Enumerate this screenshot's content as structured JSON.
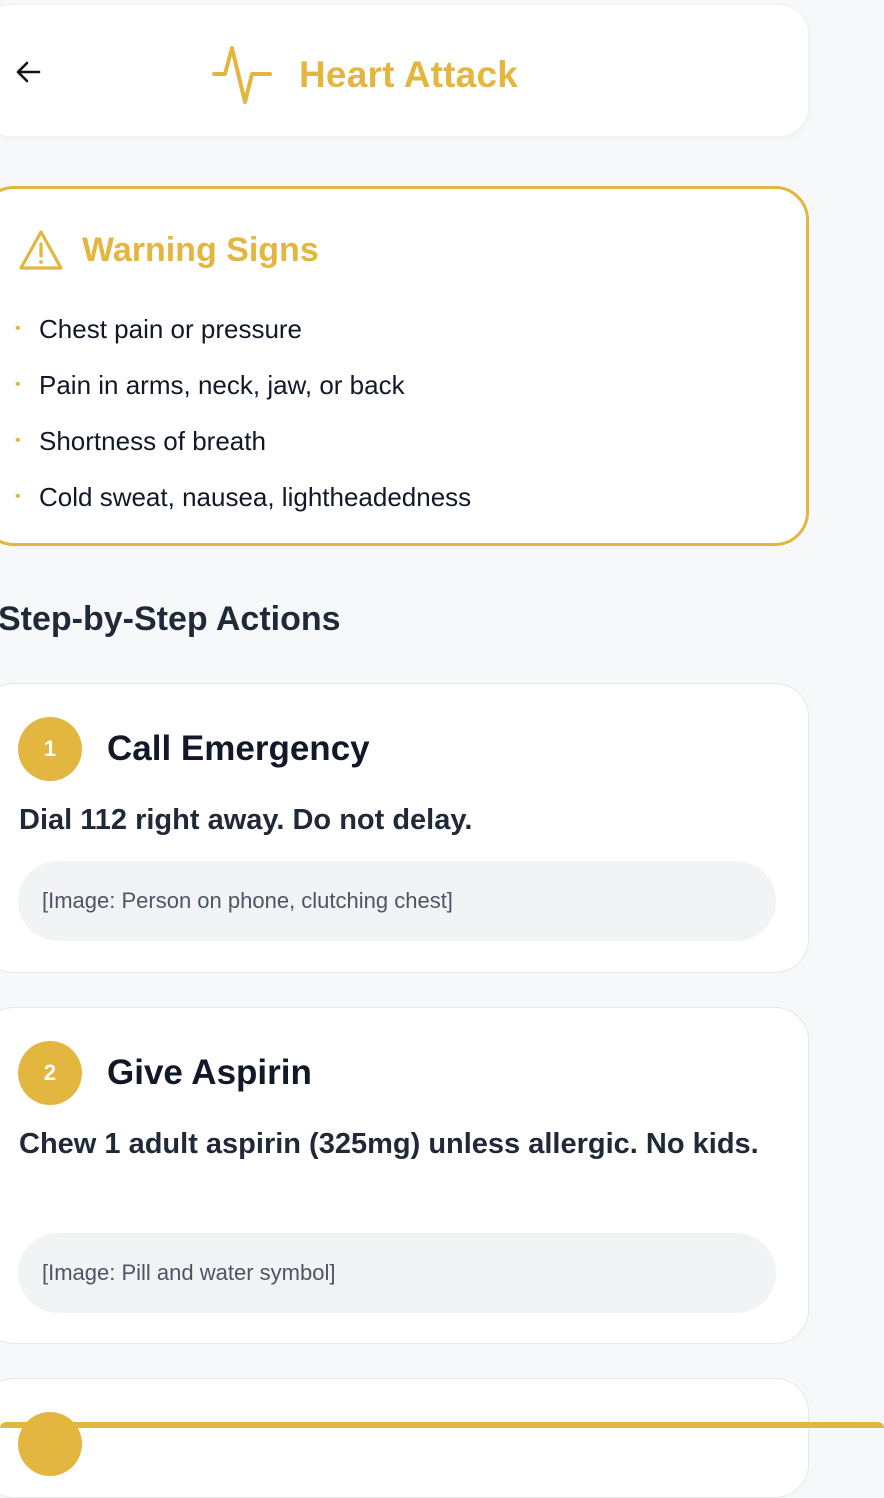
{
  "header": {
    "title": "Heart Attack",
    "back_icon": "arrow-left-icon",
    "title_icon": "heartbeat-pulse-icon",
    "accent": "#e2b63f"
  },
  "warning": {
    "title": "Warning Signs",
    "icon": "warning-triangle-icon",
    "items": [
      "Chest pain or pressure",
      "Pain in arms, neck, jaw, or back",
      "Shortness of breath",
      "Cold sweat, nausea, lightheadedness"
    ]
  },
  "steps_section": {
    "title": "Step-by-Step Actions",
    "steps": [
      {
        "number": "1",
        "title": "Call Emergency",
        "description": "Dial 112 right away. Do not delay.",
        "image_caption": "[Image: Person on phone, clutching chest]"
      },
      {
        "number": "2",
        "title": "Give Aspirin",
        "description": "Chew 1 adult aspirin (325mg) unless allergic. No kids.",
        "image_caption": "[Image: Pill and water symbol]"
      }
    ]
  }
}
